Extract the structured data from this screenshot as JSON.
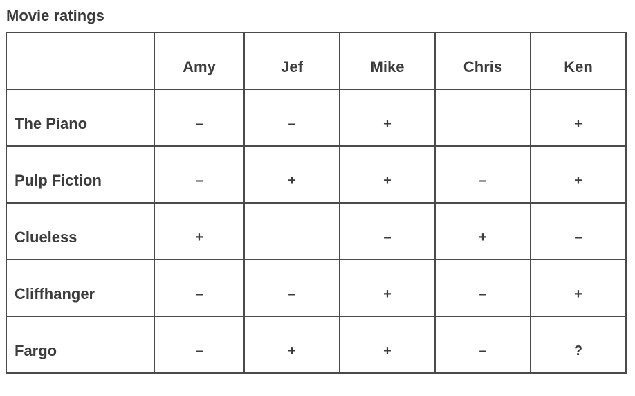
{
  "title": "Movie ratings",
  "table": {
    "corner": "",
    "columns": [
      "Amy",
      "Jef",
      "Mike",
      "Chris",
      "Ken"
    ],
    "rows": [
      {
        "movie": "The Piano",
        "ratings": [
          "–",
          "–",
          "+",
          "",
          "+"
        ]
      },
      {
        "movie": "Pulp Fiction",
        "ratings": [
          "–",
          "+",
          "+",
          "–",
          "+"
        ]
      },
      {
        "movie": "Clueless",
        "ratings": [
          "+",
          "",
          "–",
          "+",
          "–"
        ]
      },
      {
        "movie": "Cliffhanger",
        "ratings": [
          "–",
          "–",
          "+",
          "–",
          "+"
        ]
      },
      {
        "movie": "Fargo",
        "ratings": [
          "–",
          "+",
          "+",
          "–",
          "?"
        ]
      }
    ]
  }
}
